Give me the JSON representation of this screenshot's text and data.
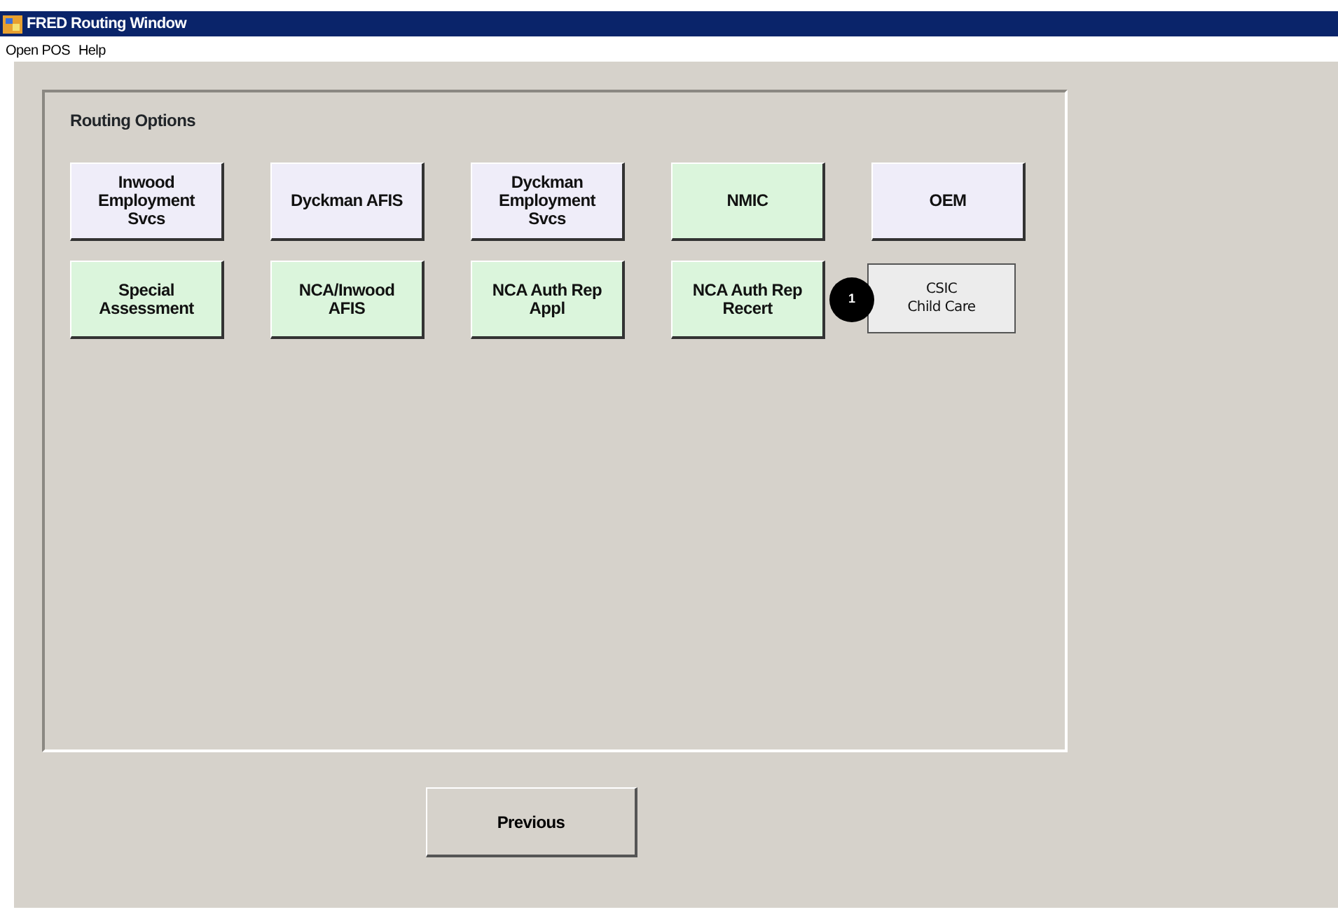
{
  "window": {
    "title": "FRED Routing Window"
  },
  "menu": [
    "Open POS",
    "Help"
  ],
  "group": {
    "title": "Routing Options",
    "buttons": [
      {
        "label": "Inwood\nEmployment\nSvcs",
        "color": "#efedf9",
        "kind": "bevel"
      },
      {
        "label": "Dyckman AFIS",
        "color": "#efedf9",
        "kind": "bevel"
      },
      {
        "label": "Dyckman\nEmployment\nSvcs",
        "color": "#efedf9",
        "kind": "bevel"
      },
      {
        "label": "NMIC",
        "color": "#dbf5dc",
        "kind": "bevel"
      },
      {
        "label": "OEM",
        "color": "#efedf9",
        "kind": "bevel"
      },
      {
        "label": "Special\nAssessment",
        "color": "#dbf5dc",
        "kind": "bevel"
      },
      {
        "label": "NCA/Inwood\nAFIS",
        "color": "#dbf5dc",
        "kind": "bevel"
      },
      {
        "label": "NCA Auth Rep\nAppl",
        "color": "#dbf5dc",
        "kind": "bevel"
      },
      {
        "label": "NCA Auth Rep\nRecert",
        "color": "#dbf5dc",
        "kind": "bevel"
      },
      {
        "label": "CSIC\nChild Care",
        "color": "#ececec",
        "kind": "flat",
        "callout": "1"
      }
    ]
  },
  "footer_button": "Previous"
}
